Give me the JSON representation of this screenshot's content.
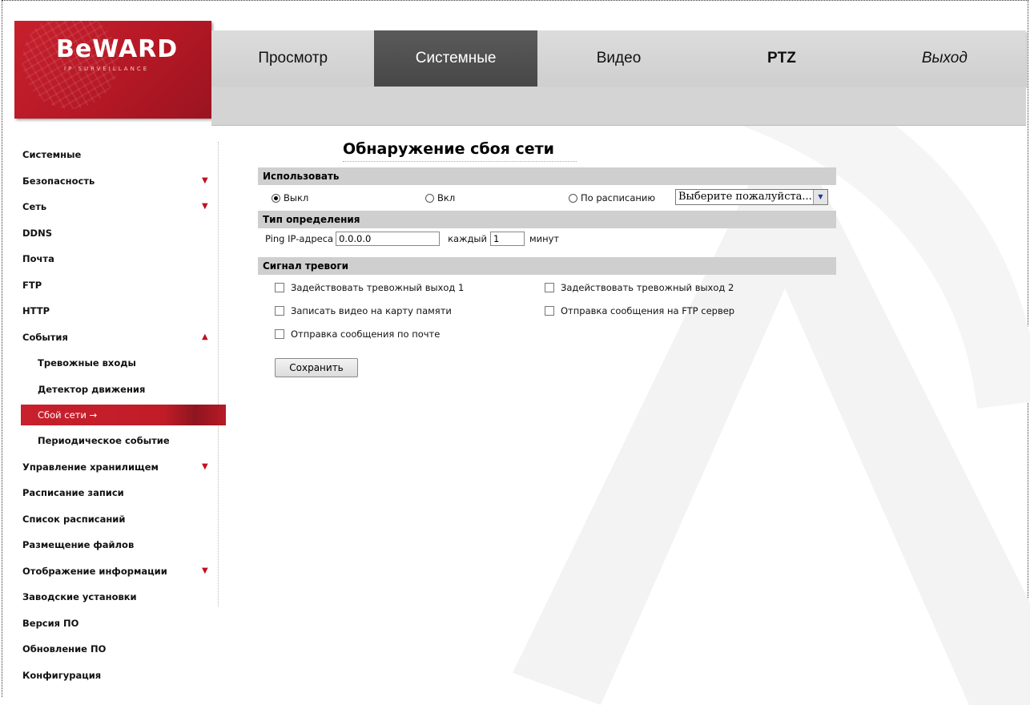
{
  "brand": {
    "logo_text": "BeWARD",
    "logo_sub": "IP SURVEILLANCE"
  },
  "topnav": {
    "tabs": [
      {
        "label": "Просмотр"
      },
      {
        "label": "Системные"
      },
      {
        "label": "Видео"
      },
      {
        "label": "PTZ"
      },
      {
        "label": "Выход"
      }
    ],
    "active": "Системные"
  },
  "sidebar": {
    "items": [
      {
        "label": "Системные"
      },
      {
        "label": "Безопасность",
        "expand": "collapsed"
      },
      {
        "label": "Сеть",
        "expand": "collapsed"
      },
      {
        "label": "DDNS"
      },
      {
        "label": "Почта"
      },
      {
        "label": "FTP"
      },
      {
        "label": "HTTP"
      },
      {
        "label": "События",
        "expand": "expanded"
      },
      {
        "label": "Тревожные входы",
        "sub": true
      },
      {
        "label": "Детектор движения",
        "sub": true
      },
      {
        "label": "Сбой сети →",
        "sub": true,
        "active": true
      },
      {
        "label": "Периодическое событие",
        "sub": true
      },
      {
        "label": "Управление хранилищем",
        "expand": "collapsed"
      },
      {
        "label": "Расписание записи"
      },
      {
        "label": "Список расписаний"
      },
      {
        "label": "Размещение файлов"
      },
      {
        "label": "Отображение информации",
        "expand": "collapsed"
      },
      {
        "label": "Заводские установки"
      },
      {
        "label": "Версия ПО"
      },
      {
        "label": "Обновление ПО"
      },
      {
        "label": "Конфигурация"
      }
    ]
  },
  "main": {
    "title": "Обнаружение сбоя сети",
    "use_section": {
      "header": "Использовать",
      "off_label": "Выкл",
      "on_label": "Вкл",
      "schedule_label": "По расписанию",
      "selected": "Выкл",
      "schedule_select": "Выберите пожалуйста..."
    },
    "detect_section": {
      "header": "Тип определения",
      "ping_label": "Ping IP-адреса",
      "ip_value": "0.0.0.0",
      "every_label": "каждый",
      "interval_value": "1",
      "minutes_label": "минут"
    },
    "alarm_section": {
      "header": "Сигнал тревоги",
      "out1": "Задействовать тревожный выход 1",
      "out2": "Задействовать тревожный выход 2",
      "record_sd": "Записать видео на карту памяти",
      "send_ftp": "Отправка сообщения на FTP сервер",
      "send_mail": "Отправка сообщения по почте"
    },
    "save_button": "Сохранить"
  },
  "colors": {
    "brand_red": "#c8202d",
    "nav_active": "#4f4f4f",
    "section_bg": "#cfcfcf"
  }
}
